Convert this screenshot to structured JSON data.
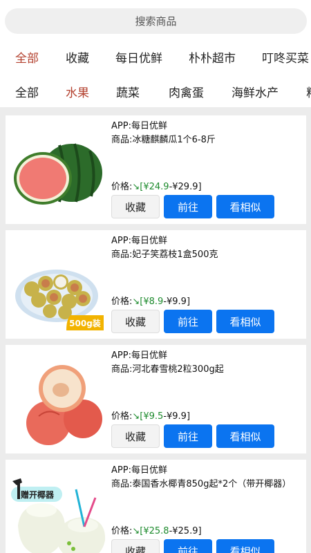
{
  "search": {
    "placeholder": "搜索商品"
  },
  "app_tabs": [
    {
      "label": "全部",
      "active": true
    },
    {
      "label": "收藏",
      "active": false
    },
    {
      "label": "每日优鲜",
      "active": false
    },
    {
      "label": "朴朴超市",
      "active": false
    },
    {
      "label": "叮咚买菜",
      "active": false
    }
  ],
  "category_tabs": [
    {
      "label": "全部",
      "active": false
    },
    {
      "label": "水果",
      "active": true
    },
    {
      "label": "蔬菜",
      "active": false
    },
    {
      "label": "肉禽蛋",
      "active": false
    },
    {
      "label": "海鲜水产",
      "active": false
    },
    {
      "label": "粮",
      "active": false
    }
  ],
  "products": [
    {
      "app_line": "APP:每日优鲜",
      "name_line": "商品:冰糖麒麟瓜1个6-8斤",
      "price_prefix": "价格:",
      "price_low": "¥24.9",
      "price_high": "-¥29.9",
      "badge": "",
      "image_icon": "watermelon-image",
      "buttons": {
        "fav": "收藏",
        "go": "前往",
        "similar": "看相似"
      }
    },
    {
      "app_line": "APP:每日优鲜",
      "name_line": "商品:妃子笑荔枝1盒500克",
      "price_prefix": "价格:",
      "price_low": "¥8.9",
      "price_high": "-¥9.9",
      "badge": "500g装",
      "image_icon": "lychee-image",
      "buttons": {
        "fav": "收藏",
        "go": "前往",
        "similar": "看相似"
      }
    },
    {
      "app_line": "APP:每日优鲜",
      "name_line": "商品:河北春雪桃2粒300g起",
      "price_prefix": "价格:",
      "price_low": "¥9.5",
      "price_high": "-¥9.9",
      "badge": "",
      "image_icon": "peach-image",
      "buttons": {
        "fav": "收藏",
        "go": "前往",
        "similar": "看相似"
      }
    },
    {
      "app_line": "APP:每日优鲜",
      "name_line": "商品:泰国香水椰青850g起*2个（带开椰器）",
      "price_prefix": "价格:",
      "price_low": "¥25.8",
      "price_high": "-¥25.9",
      "badge": "赠开椰器",
      "image_icon": "coconut-image",
      "buttons": {
        "fav": "收藏",
        "go": "前往",
        "similar": "看相似"
      }
    }
  ],
  "colors": {
    "active_tab": "#b3402e",
    "price_low": "#1c8a2c",
    "primary_button": "#0b74f0"
  }
}
